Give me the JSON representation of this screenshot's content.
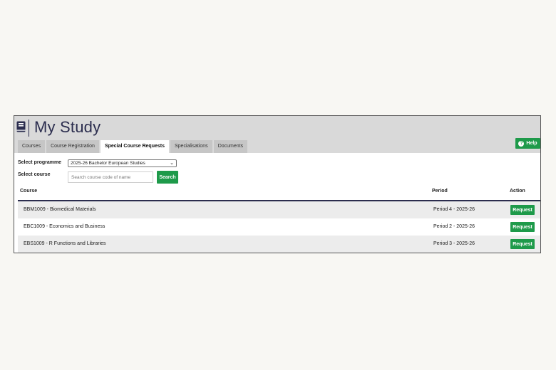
{
  "app": {
    "title": "My Study",
    "logo_icon": "book-icon"
  },
  "tabs": [
    {
      "label": "Courses",
      "active": false
    },
    {
      "label": "Course Registration",
      "active": false
    },
    {
      "label": "Special Course Requests",
      "active": true
    },
    {
      "label": "Specialisations",
      "active": false
    },
    {
      "label": "Documents",
      "active": false
    }
  ],
  "help": {
    "label": "Help",
    "icon": "help-circle-icon"
  },
  "form": {
    "programme_label": "Select programme",
    "programme_value": "2025-26 Bachelor European Studies",
    "course_label": "Select course",
    "course_placeholder": "Search course code of name",
    "search_label": "Search"
  },
  "table": {
    "headers": {
      "course": "Course",
      "period": "Period",
      "action": "Action"
    },
    "rows": [
      {
        "course": "BBM1009 - Biomedical Materials",
        "period": "Period 4 - 2025-26",
        "action": "Request"
      },
      {
        "course": "EBC1009 - Economics and Business",
        "period": "Period 2 - 2025-26",
        "action": "Request"
      },
      {
        "course": "EBS1009 - R Functions and Libraries",
        "period": "Period 3 - 2025-26",
        "action": "Request"
      }
    ]
  },
  "colors": {
    "accent_green": "#1e9a4a",
    "navy": "#2b2d4e",
    "header_gray": "#d9d9d9"
  }
}
